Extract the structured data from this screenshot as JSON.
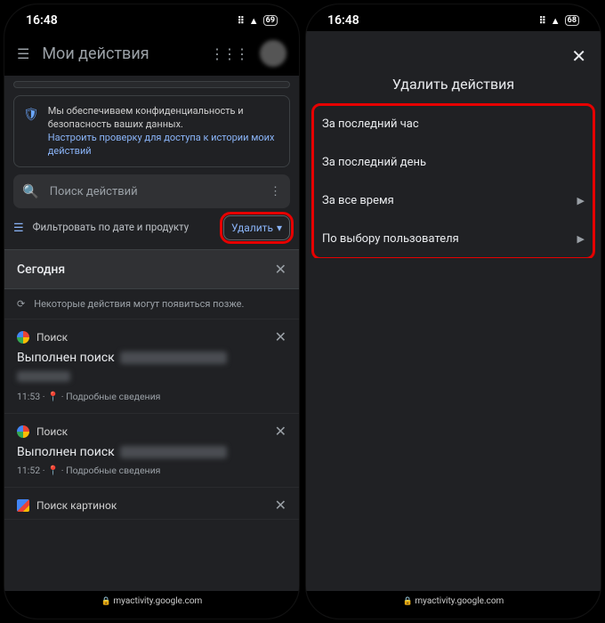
{
  "status": {
    "time": "16:48",
    "battery_left": "69",
    "battery_right": "68"
  },
  "left": {
    "title": "Мои действия",
    "privacy": {
      "text": "Мы обеспечиваем конфиденциальность и безопасность ваших данных.",
      "link": "Настроить проверку для доступа к истории моих действий"
    },
    "search_placeholder": "Поиск действий",
    "filter_label": "Фильтровать по дате и продукту",
    "delete_label": "Удалить",
    "today": "Сегодня",
    "info": "Некоторые действия могут появиться позже.",
    "activities": [
      {
        "service": "Поиск",
        "action": "Выполнен поиск",
        "time": "11:53",
        "details": "Подробные сведения"
      },
      {
        "service": "Поиск",
        "action": "Выполнен поиск",
        "time": "11:52",
        "details": "Подробные сведения"
      }
    ],
    "images_service": "Поиск картинок",
    "url": "myactivity.google.com"
  },
  "right": {
    "title": "Удалить действия",
    "options": [
      {
        "label": "За последний час",
        "chevron": false
      },
      {
        "label": "За последний день",
        "chevron": false
      },
      {
        "label": "За все время",
        "chevron": true
      },
      {
        "label": "По выбору пользователя",
        "chevron": true
      }
    ],
    "url": "myactivity.google.com"
  }
}
